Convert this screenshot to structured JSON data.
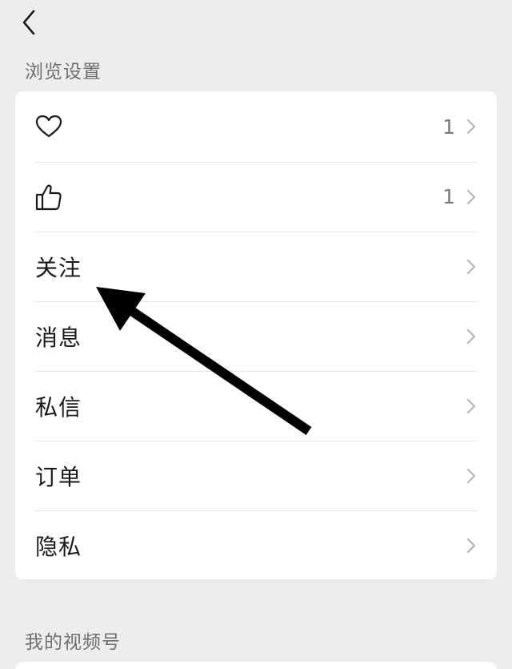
{
  "sections": [
    {
      "title": "浏览设置",
      "items": [
        {
          "icon": "heart-icon",
          "label": "",
          "count": "1"
        },
        {
          "icon": "thumbs-up-icon",
          "label": "",
          "count": "1"
        },
        {
          "icon": "",
          "label": "关注",
          "count": ""
        },
        {
          "icon": "",
          "label": "消息",
          "count": ""
        },
        {
          "icon": "",
          "label": "私信",
          "count": ""
        },
        {
          "icon": "",
          "label": "订单",
          "count": ""
        },
        {
          "icon": "",
          "label": "隐私",
          "count": ""
        }
      ]
    },
    {
      "title": "我的视频号"
    }
  ],
  "colors": {
    "background": "#ededed",
    "card": "#ffffff",
    "section_title": "#6e6e6e",
    "divider": "#e6e6e6",
    "chevron": "#b2b2b2",
    "annotation_arrow": "#000000"
  }
}
